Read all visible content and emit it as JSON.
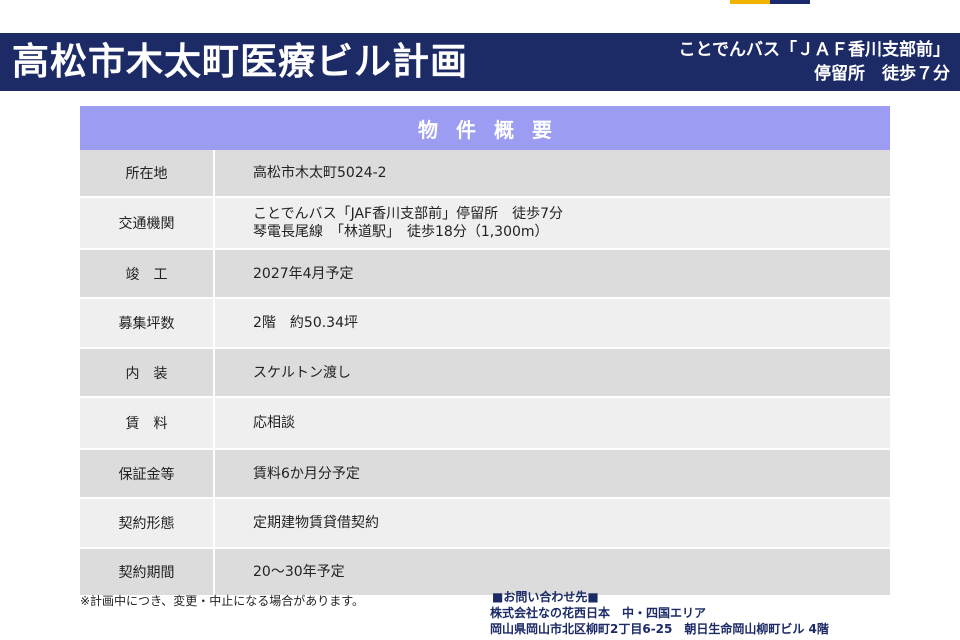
{
  "header": {
    "title": "高松市木太町医療ビル計画",
    "access_line1": "ことでんバス「ＪＡＦ香川支部前」",
    "access_line2": "停留所　徒歩７分"
  },
  "summary": {
    "heading": "物件概要",
    "rows": [
      {
        "label": "所在地",
        "lines": [
          "高松市木太町5024-2"
        ]
      },
      {
        "label": "交通機関",
        "lines": [
          "ことでんバス「JAF香川支部前」停留所　徒歩7分",
          "琴電長尾線　「林道駅」　徒歩18分（1,300m）"
        ]
      },
      {
        "label": "竣　工",
        "lines": [
          "2027年4月予定"
        ]
      },
      {
        "label": "募集坪数",
        "lines": [
          "2階　約50.34坪"
        ]
      },
      {
        "label": "内　装",
        "lines": [
          "スケルトン渡し"
        ]
      },
      {
        "label": "賃　料",
        "lines": [
          "応相談"
        ]
      },
      {
        "label": "保証金等",
        "lines": [
          "賃料6か月分予定"
        ]
      },
      {
        "label": "契約形態",
        "lines": [
          "定期建物賃貸借契約"
        ]
      },
      {
        "label": "契約期間",
        "lines": [
          "20～30年予定"
        ]
      }
    ]
  },
  "note": "※計画中につき、変更・中止になる場合があります。",
  "contact": {
    "heading": "■お問い合わせ先■",
    "company": "株式会社なの花西日本　中・四国エリア",
    "address": "岡山県岡山市北区柳町2丁目6-25　朝日生命岡山柳町ビル 4階"
  },
  "colors": {
    "header_bg": "#1c2a66",
    "summary_head_bg": "#9b9cf2",
    "row_dark": "#dcdcdc",
    "row_light": "#efefef"
  }
}
